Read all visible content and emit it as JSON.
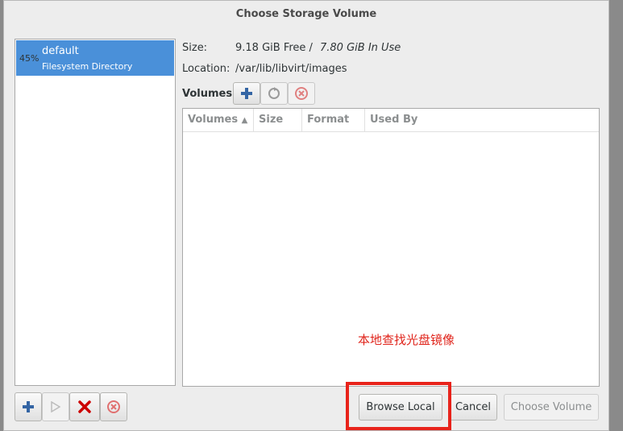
{
  "dialog": {
    "title": "Choose Storage Volume"
  },
  "pools": [
    {
      "percent": "45%",
      "name": "default",
      "type": "Filesystem Directory",
      "selected": true
    }
  ],
  "details": {
    "size_label": "Size:",
    "size_free": "9.18 GiB Free /",
    "size_in_use": "7.80 GiB In Use",
    "location_label": "Location:",
    "location_value": "/var/lib/libvirt/images",
    "volumes_label": "Volumes"
  },
  "volume_table": {
    "columns": [
      "Volumes",
      "Size",
      "Format",
      "Used By"
    ],
    "sort_indicator": "▲",
    "rows": []
  },
  "annotation": {
    "text": "本地查找光盘镜像",
    "color": "#e0241b"
  },
  "buttons": {
    "browse_local": "Browse Local",
    "cancel": "Cancel",
    "choose_volume": "Choose Volume"
  },
  "icons": {
    "add": "add-icon",
    "refresh": "refresh-icon",
    "delete": "delete-icon",
    "start": "play-icon",
    "stop": "stop-icon"
  },
  "colors": {
    "selection": "#4a90d9",
    "highlight_box": "#e8231b"
  }
}
